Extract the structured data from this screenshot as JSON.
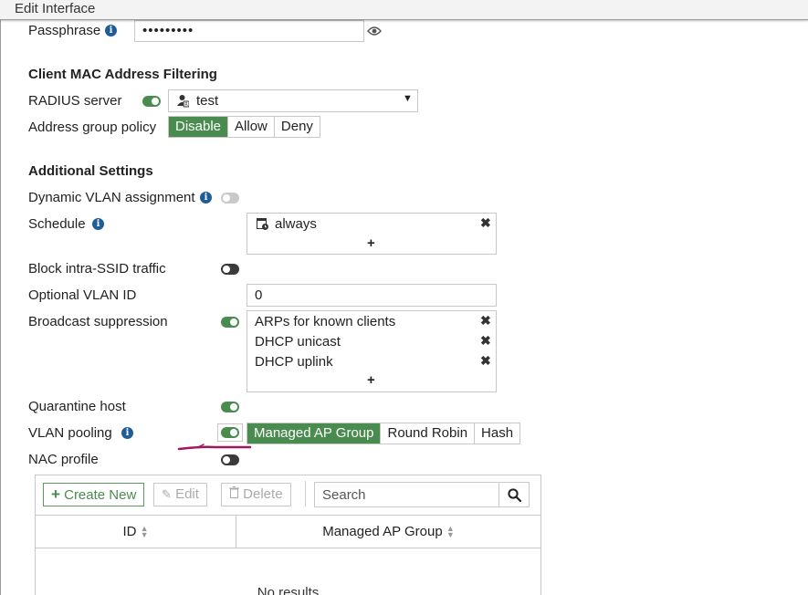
{
  "window": {
    "title": "Edit Interface"
  },
  "passphrase": {
    "label": "Passphrase",
    "value": "•••••••••"
  },
  "mac_filtering": {
    "title": "Client MAC Address Filtering",
    "radius_label": "RADIUS server",
    "radius_value": "test",
    "addr_policy_label": "Address group policy",
    "addr_policy_options": [
      "Disable",
      "Allow",
      "Deny"
    ],
    "addr_policy_selected": "Disable"
  },
  "additional": {
    "title": "Additional Settings",
    "dynamic_vlan_label": "Dynamic VLAN assignment",
    "schedule_label": "Schedule",
    "schedule_value": "always",
    "block_intra_label": "Block intra-SSID traffic",
    "optional_vlan_label": "Optional VLAN ID",
    "optional_vlan_value": "0",
    "broadcast_label": "Broadcast suppression",
    "broadcast_items": [
      "ARPs for known clients",
      "DHCP unicast",
      "DHCP uplink"
    ],
    "quarantine_label": "Quarantine host",
    "vlan_pooling_label": "VLAN pooling",
    "vlan_pooling_options": [
      "Managed AP Group",
      "Round Robin",
      "Hash"
    ],
    "vlan_pooling_selected": "Managed AP Group",
    "nac_label": "NAC profile"
  },
  "table": {
    "create_label": "Create New",
    "edit_label": "Edit",
    "delete_label": "Delete",
    "search_placeholder": "Search",
    "columns": [
      "ID",
      "Managed AP Group"
    ],
    "empty_text": "No results"
  },
  "colors": {
    "accent": "#4a8c4f",
    "info": "#1f5d99",
    "annotation": "#a0185e"
  }
}
